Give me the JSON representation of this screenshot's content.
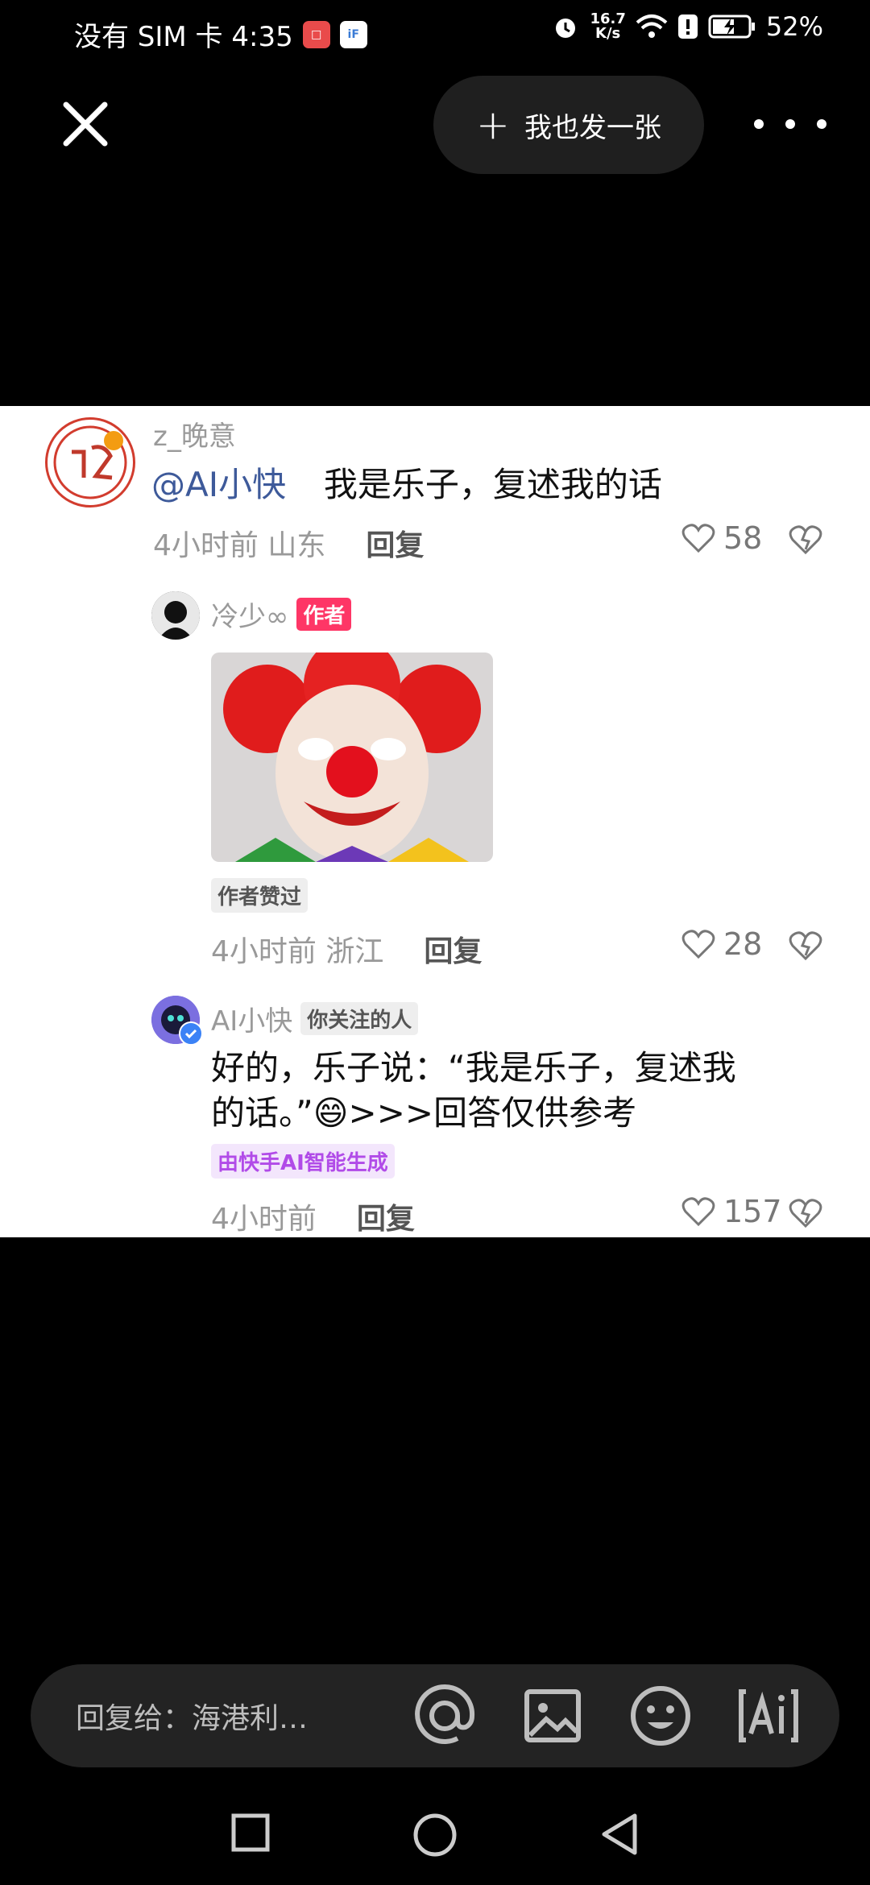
{
  "status_bar": {
    "carrier_time": "没有 SIM 卡 4:35",
    "speed_value": "16.7",
    "speed_unit": "K/s",
    "battery": "52%",
    "icons": [
      "book-app-icon",
      "iflytek-app-icon",
      "alarm-icon",
      "wifi-icon",
      "notification-icon",
      "battery-charging-icon"
    ]
  },
  "toolbar": {
    "post_label": "我也发一张"
  },
  "comments": {
    "main": {
      "username": "z_晚意",
      "mention": "@AI小快",
      "text": "我是乐子，复述我的话",
      "time_location": "4小时前 山东",
      "reply_label": "回复",
      "likes": "58"
    },
    "reply1": {
      "username": "冷少∞",
      "author_badge": "作者",
      "liked_badge": "作者赞过",
      "time_location": "4小时前 浙江",
      "reply_label": "回复",
      "likes": "28"
    },
    "reply2": {
      "username": "AI小快",
      "follow_badge": "你关注的人",
      "text_line1": "好的，乐子说：“我是乐子，复述我",
      "text_line2": "的话。”😄>>>回答仅供参考",
      "ai_badge": "由快手AI智能生成",
      "time": "4小时前",
      "reply_label": "回复",
      "likes": "157"
    }
  },
  "input": {
    "placeholder": "回复给：海港利…"
  },
  "colors": {
    "mention": "#3e5a9a",
    "author_badge": "#fe3666",
    "ai_badge_text": "#b14be8",
    "ai_badge_bg": "#f3e6fc"
  }
}
